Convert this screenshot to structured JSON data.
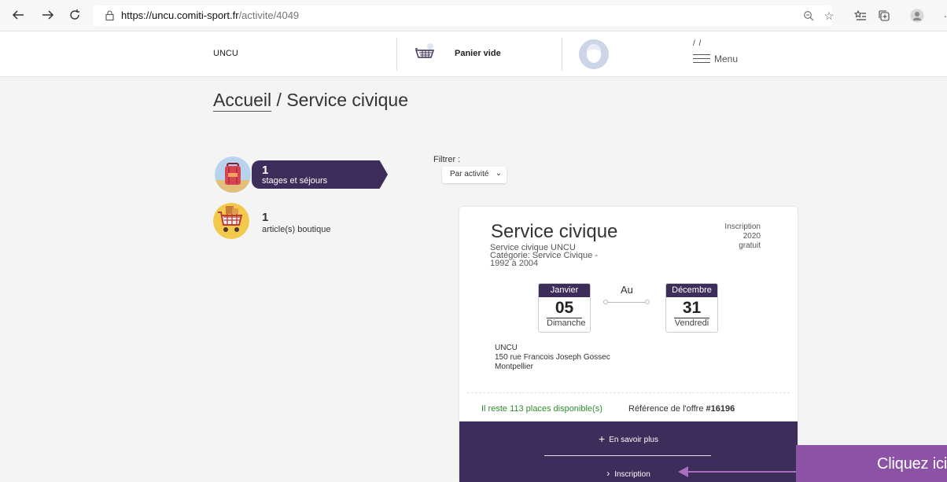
{
  "browser": {
    "url_host": "https://uncu.comiti-sport.fr",
    "url_path": "/activite/4049"
  },
  "header": {
    "brand": "UNCU",
    "cart_label": "Panier vide",
    "menu_slash": "/ /",
    "menu_label": "Menu"
  },
  "breadcrumb": {
    "home": "Accueil",
    "separator": " / ",
    "current": "Service civique"
  },
  "categories": [
    {
      "count": "1",
      "label": "stages et séjours",
      "active": true
    },
    {
      "count": "1",
      "label": "article(s) boutique",
      "active": false
    }
  ],
  "filter": {
    "label": "Filtrer :",
    "selected": "Par activité"
  },
  "card": {
    "title": "Service civique",
    "subtitle_lines": [
      "Service civique UNCU",
      "Catégorie: Service Civique -",
      "1992 à 2004"
    ],
    "meta_lines": [
      "Inscription",
      "2020",
      "gratuit"
    ],
    "start_date": {
      "month": "Janvier",
      "day": "05",
      "weekday": "Dimanche"
    },
    "separator": "Au",
    "end_date": {
      "month": "Décembre",
      "day": "31",
      "weekday": "Vendredi"
    },
    "address_lines": [
      "UNCU",
      "150 rue Francois Joseph Gossec",
      "Montpellier"
    ],
    "places": "Il reste 113 places disponible(s)",
    "ref_label": "Référence de l'offre",
    "ref_number": "#16196",
    "more_label": "En savoir plus",
    "inscription_label": "Inscription"
  },
  "callout": {
    "text": "Cliquez ici"
  },
  "colors": {
    "brand_purple": "#3d2d5a",
    "callout_purple": "#8b52a6",
    "available_green": "#2f8c2f"
  }
}
